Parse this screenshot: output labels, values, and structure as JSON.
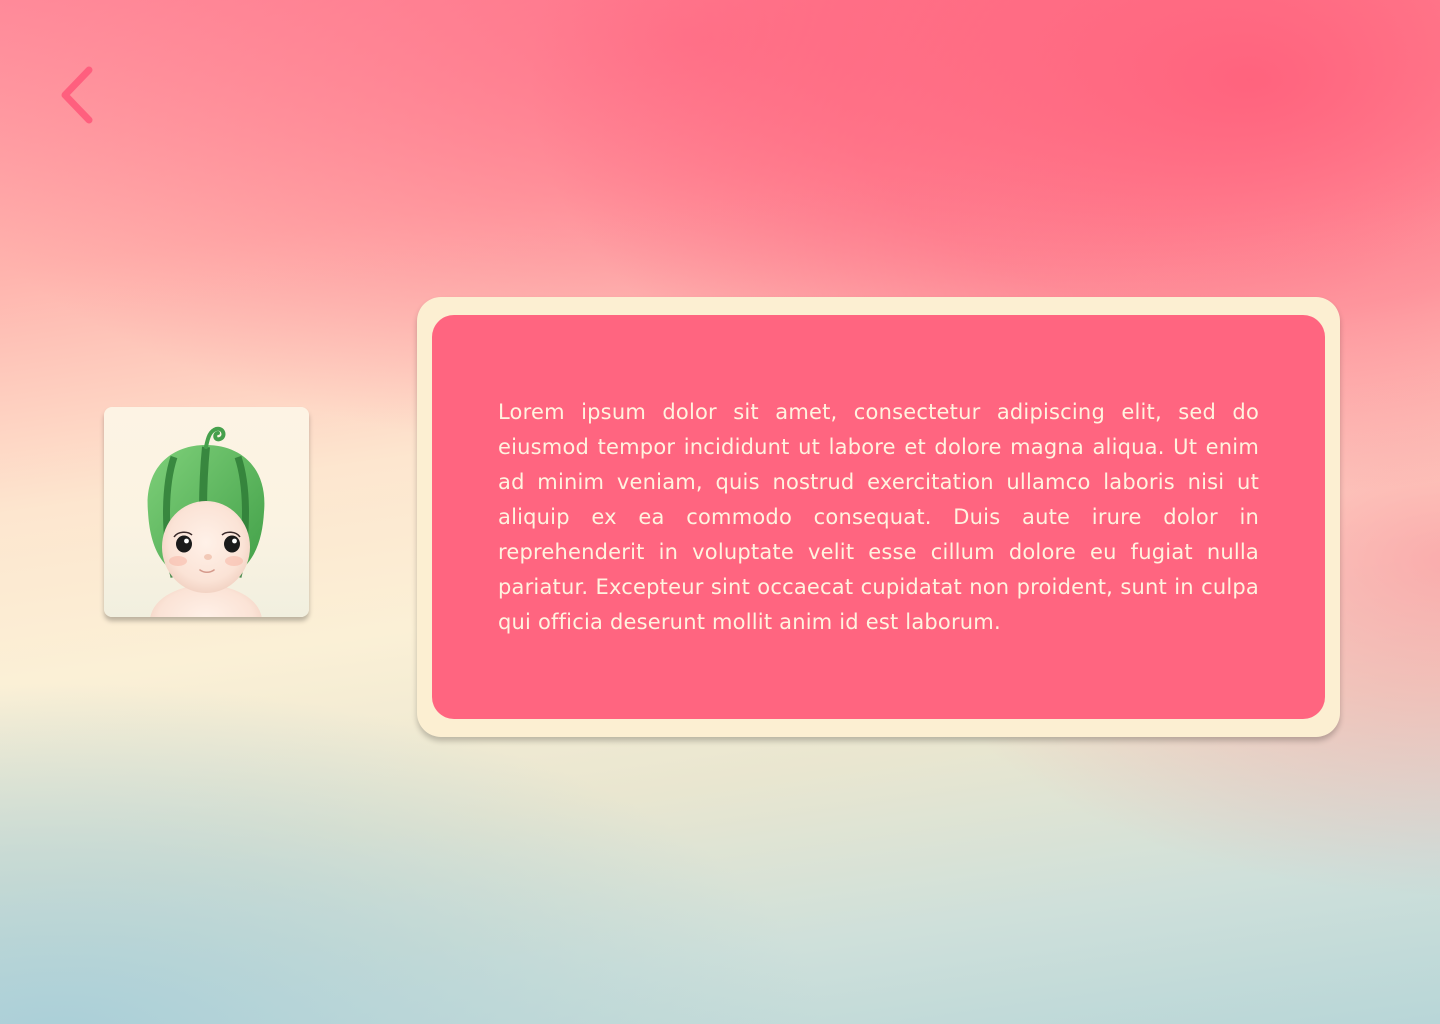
{
  "navigation": {
    "back_icon": "chevron-left-icon"
  },
  "avatar": {
    "icon": "watermelon-doll-figure"
  },
  "card": {
    "body": "Lorem ipsum dolor sit amet, consectetur adipiscing elit, sed do eiusmod tempor incididunt ut labore et dolore magna aliqua. Ut enim ad minim veniam, quis nostrud exercitation ullamco laboris nisi ut aliquip ex ea commodo consequat. Duis aute irure dolor in reprehenderit in voluptate velit esse cillum dolore eu fugiat nulla pariatur. Excepteur sint occaecat cupidatat non proident, sunt in culpa qui officia deserunt mollit anim id est laborum."
  },
  "colors": {
    "accent_pink": "#ff6580",
    "card_frame": "#fcefd2",
    "card_text": "#fff3df",
    "back_icon": "#ff5f7e"
  }
}
